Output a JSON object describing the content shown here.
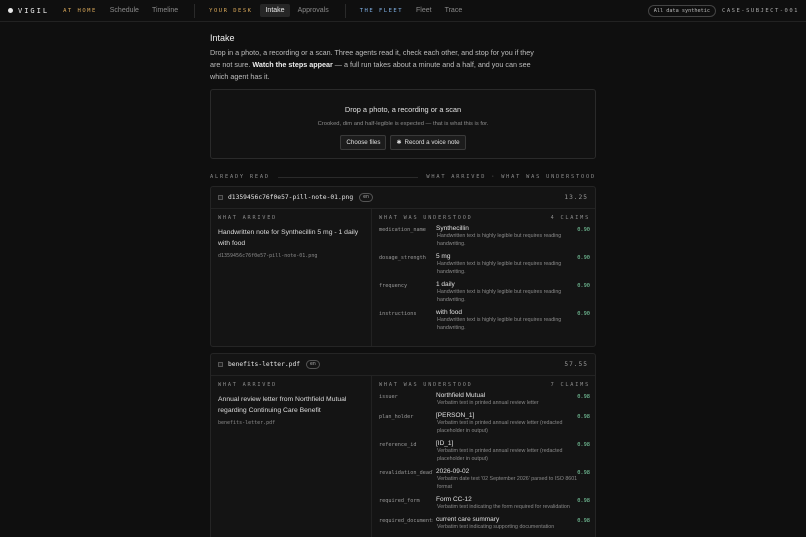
{
  "app": {
    "name": "VIGIL"
  },
  "nav": {
    "groups": [
      {
        "label": "AT HOME",
        "color": "#d9a85a",
        "items": [
          {
            "label": "Schedule",
            "active": false
          },
          {
            "label": "Timeline",
            "active": false
          }
        ]
      },
      {
        "label": "YOUR DESK",
        "color": "#d9a85a",
        "items": [
          {
            "label": "Intake",
            "active": true
          },
          {
            "label": "Approvals",
            "active": false
          }
        ]
      },
      {
        "label": "THE FLEET",
        "color": "#7fb0e6",
        "items": [
          {
            "label": "Fleet",
            "active": false
          },
          {
            "label": "Trace",
            "active": false
          }
        ]
      }
    ],
    "badge": "All data synthetic",
    "case_id": "CASE-SUBJECT-001"
  },
  "page": {
    "title": "Intake",
    "intro_1": "Drop in a photo, a recording or a scan. Three agents read it, check each other, and stop for you if they are not sure. ",
    "intro_bold": "Watch the steps appear",
    "intro_2": " — a full run takes about a minute and a half, and you can see which agent has it."
  },
  "dropzone": {
    "title": "Drop a photo, a recording or a scan",
    "subtitle": "Crooked, dim and half-legible is expected — that is what this is for.",
    "choose_label": "Choose files",
    "record_label": "Record a voice note",
    "record_icon": "mic-icon"
  },
  "already_read": {
    "label": "ALREADY READ",
    "legend": "WHAT ARRIVED · WHAT WAS UNDERSTOOD"
  },
  "labels": {
    "arrived": "WHAT ARRIVED",
    "understood": "WHAT WAS UNDERSTOOD"
  },
  "colors": {
    "accent_amber": "#d9a85a",
    "accent_blue": "#7fb0e6",
    "confidence": "#7fd6a8"
  },
  "cards": [
    {
      "filename": "d1359456c76f0e57-pill-note-01.png",
      "lang": "en",
      "time": "13.25",
      "arrived_desc": "Handwritten note for Synthecillin 5 mg - 1 daily with food",
      "arrived_file": "d1359456c76f0e57-pill-note-01.png",
      "claims": "4 CLAIMS",
      "fields": [
        {
          "key": "medication_name",
          "value": "Synthecillin",
          "note": "Handwritten text is highly legible but requires reading handwriting.",
          "conf": "0.90"
        },
        {
          "key": "dosage_strength",
          "value": "5 mg",
          "note": "Handwritten text is highly legible but requires reading handwriting.",
          "conf": "0.90"
        },
        {
          "key": "frequency",
          "value": "1 daily",
          "note": "Handwritten text is highly legible but requires reading handwriting.",
          "conf": "0.90"
        },
        {
          "key": "instructions",
          "value": "with food",
          "note": "Handwritten text is highly legible but requires reading handwriting.",
          "conf": "0.90"
        }
      ]
    },
    {
      "filename": "benefits-letter.pdf",
      "lang": "en",
      "time": "57.55",
      "arrived_desc": "Annual review letter from Northfield Mutual regarding Continuing Care Benefit",
      "arrived_file": "benefits-letter.pdf",
      "claims": "7 CLAIMS",
      "fields": [
        {
          "key": "issuer",
          "value": "Northfield Mutual",
          "note": "Verbatim text in printed annual review letter",
          "conf": "0.98"
        },
        {
          "key": "plan_holder",
          "value": "[PERSON_1]",
          "note": "Verbatim text in printed annual review letter (redacted placeholder in output)",
          "conf": "0.98"
        },
        {
          "key": "reference_id",
          "value": "[ID_1]",
          "note": "Verbatim text in printed annual review letter (redacted placeholder in output)",
          "conf": "0.98"
        },
        {
          "key": "revalidation_deadline",
          "value": "2026-09-02",
          "note": "Verbatim date text '02 September 2026' parsed to ISO 8601 format",
          "conf": "0.98"
        },
        {
          "key": "required_form",
          "value": "Form CC-12",
          "note": "Verbatim text indicating the form required for revalidation",
          "conf": "0.98"
        },
        {
          "key": "required_documents",
          "value": "current care summary",
          "note": "Verbatim text indicating supporting documentation",
          "conf": "0.98"
        }
      ]
    }
  ]
}
